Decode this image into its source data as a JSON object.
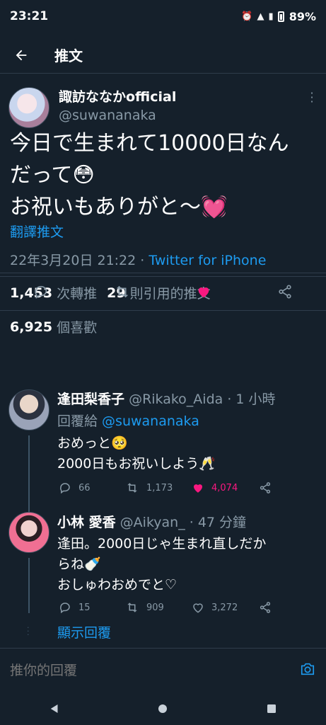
{
  "status": {
    "time": "23:21",
    "battery": "89%"
  },
  "header": {
    "title": "推文"
  },
  "tweet": {
    "author_name": "諏訪ななかofficial",
    "author_handle": "@suwananaka",
    "text_lines": [
      "今日で生まれて10000日なん",
      "だって😳",
      "お祝いもありがと～💓"
    ],
    "translate": "翻譯推文",
    "timestamp": "22年3月20日 21:22",
    "separator": " · ",
    "source": "Twitter for iPhone",
    "retweets": "1,453",
    "retweets_label": "次轉推",
    "quotes": "29",
    "quotes_label": "則引用的推文",
    "likes": "6,925",
    "likes_label": "個喜歡",
    "liked_color": "#f91880"
  },
  "replies": [
    {
      "name": "逢田梨香子",
      "handle": "@Rikako_Aida",
      "time": " · 1 小時",
      "reply_prefix": "回覆給 ",
      "reply_to": "@suwananaka",
      "lines": [
        "おめっと🥺",
        "2000日もお祝いしよう🥂"
      ],
      "replies": "66",
      "retweets": "1,173",
      "likes": "4,074",
      "liked": true
    },
    {
      "name": "小林 愛香",
      "handle": "@Aikyan_",
      "time": " · 47 分鐘",
      "lines": [
        "逢田。2000日じゃ生まれ直しだか",
        "らね🍼",
        "おしゅわおめでと♡"
      ],
      "replies": "15",
      "retweets": "909",
      "likes": "3,272",
      "liked": false
    }
  ],
  "show_more": "顯示回覆",
  "compose": {
    "placeholder": "推你的回覆"
  }
}
